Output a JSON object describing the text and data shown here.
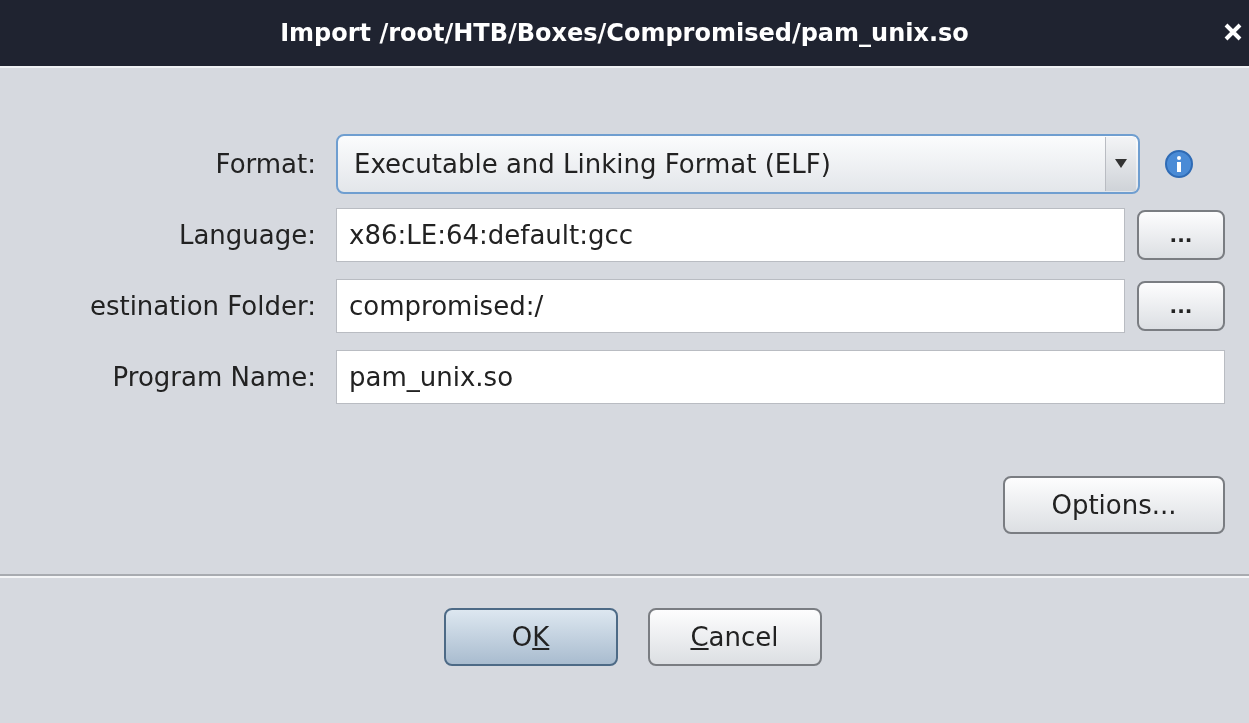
{
  "window": {
    "title": "Import /root/HTB/Boxes/Compromised/pam_unix.so"
  },
  "fields": [
    {
      "kind": "combo",
      "label": "Format:",
      "value": "Executable and Linking Format (ELF)",
      "info": true
    },
    {
      "kind": "browse",
      "label": "Language:",
      "value": "x86:LE:64:default:gcc",
      "browse": "..."
    },
    {
      "kind": "browse",
      "label": "estination Folder:",
      "value": "compromised:/",
      "browse": "..."
    },
    {
      "kind": "text",
      "label": "Program Name:",
      "value": "pam_unix.so"
    }
  ],
  "options_button": "Options...",
  "buttons": [
    {
      "text_before": "O",
      "mnemonic": "K",
      "default": true
    },
    {
      "mnemonic": "C",
      "text_after": "ancel",
      "default": false
    }
  ]
}
